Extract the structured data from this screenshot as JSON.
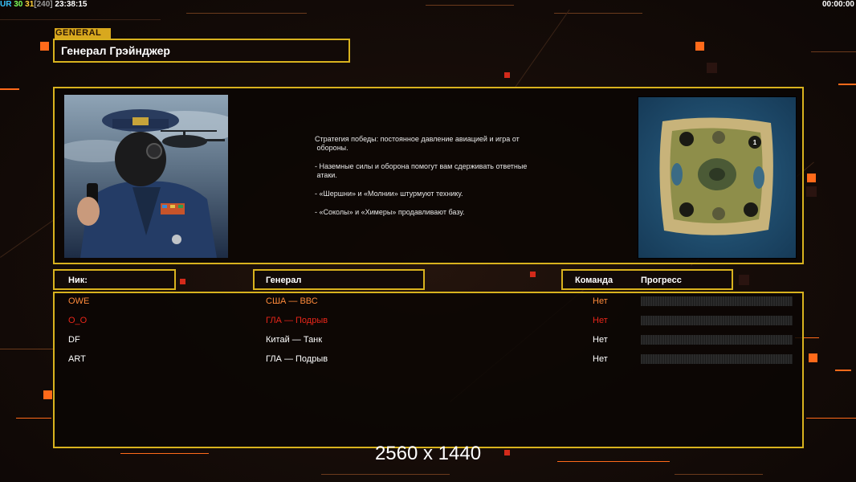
{
  "status": {
    "ur_label": "UR",
    "value_a": "30",
    "value_b": "31",
    "value_c": "[240]",
    "clock": "23:38:15",
    "timer": "00:00:00"
  },
  "general": {
    "tag": "GENERAL",
    "name": "Генерал Грэйнджер",
    "description": [
      "Стратегия победы: постоянное давление авиацией и игра от\n обороны.",
      "- Наземные силы и оборона помогут вам сдерживать ответные\n атаки.",
      "- «Шершни» и «Молнии» штурмуют технику.",
      "- «Соколы» и «Химеры» продавливают базу."
    ]
  },
  "minimap": {
    "marker": "1"
  },
  "table": {
    "headers": {
      "nick": "Ник:",
      "general": "Генерал",
      "team": "Команда",
      "progress": "Прогресс"
    },
    "rows": [
      {
        "nick": "OWE",
        "general": "США — ВВС",
        "team": "Нет",
        "progress": 0,
        "color": "#ff8a3a"
      },
      {
        "nick": "O_O",
        "general": "ГЛА — Подрыв",
        "team": "Нет",
        "progress": 0,
        "color": "#e8261a"
      },
      {
        "nick": "DF",
        "general": "Китай — Танк",
        "team": "Нет",
        "progress": 0,
        "color": "#ffffff"
      },
      {
        "nick": "ART",
        "general": "ГЛА — Подрыв",
        "team": "Нет",
        "progress": 0,
        "color": "#ffffff"
      }
    ]
  },
  "footer": {
    "resolution": "2560 x 1440"
  },
  "colors": {
    "frame": "#d8b21e",
    "accent": "#ff6a1a"
  }
}
